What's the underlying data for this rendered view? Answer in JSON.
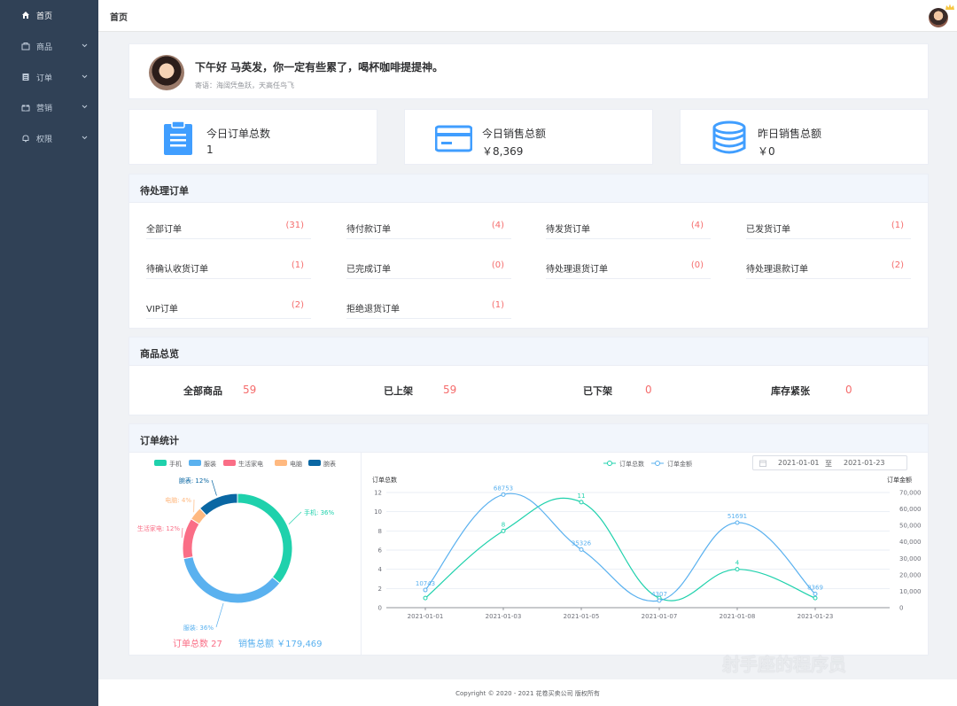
{
  "sidebar": {
    "items": [
      {
        "label": "首页",
        "icon": "home-icon",
        "has_children": false
      },
      {
        "label": "商品",
        "icon": "shop-icon",
        "has_children": true
      },
      {
        "label": "订单",
        "icon": "order-icon",
        "has_children": true
      },
      {
        "label": "营销",
        "icon": "gift-icon",
        "has_children": true
      },
      {
        "label": "权限",
        "icon": "bell-icon",
        "has_children": true
      }
    ],
    "colors": {
      "bg": "#304156",
      "text": "#bfcbd9",
      "active": "#ffffff"
    }
  },
  "header": {
    "breadcrumb": "首页"
  },
  "welcome": {
    "greeting": "下午好 马英发，你一定有些累了，喝杯咖啡提提神。",
    "motto": "寄语：海阔凭鱼跃，天高任鸟飞"
  },
  "stats": [
    {
      "label": "今日订单总数",
      "value": "1",
      "icon": "clipboard-icon"
    },
    {
      "label": "今日销售总额",
      "value": "￥8,369",
      "icon": "card-icon"
    },
    {
      "label": "昨日销售总额",
      "value": "￥0",
      "icon": "coins-icon"
    }
  ],
  "pending_orders": {
    "title": "待处理订单",
    "items": [
      {
        "label": "全部订单",
        "count": "(31)"
      },
      {
        "label": "待付款订单",
        "count": "(4)"
      },
      {
        "label": "待发货订单",
        "count": "(4)"
      },
      {
        "label": "已发货订单",
        "count": "(1)"
      },
      {
        "label": "待确认收货订单",
        "count": "(1)"
      },
      {
        "label": "已完成订单",
        "count": "(0)"
      },
      {
        "label": "待处理退货订单",
        "count": "(0)"
      },
      {
        "label": "待处理退款订单",
        "count": "(2)"
      },
      {
        "label": "VIP订单",
        "count": "(2)"
      },
      {
        "label": "拒绝退货订单",
        "count": "(1)"
      }
    ]
  },
  "goods_overview": {
    "title": "商品总览",
    "items": [
      {
        "label": "全部商品",
        "value": "59"
      },
      {
        "label": "已上架",
        "value": "59"
      },
      {
        "label": "已下架",
        "value": "0"
      },
      {
        "label": "库存紧张",
        "value": "0"
      }
    ]
  },
  "order_stats": {
    "title": "订单统计",
    "order_total_label": "订单总数 27",
    "sales_total_label": "销售总额 ￥179,469",
    "date_from": "2021-01-01",
    "date_sep": "至",
    "date_to": "2021-01-23"
  },
  "chart_data": [
    {
      "type": "pie",
      "legend": [
        "手机",
        "服装",
        "生活家电",
        "电脑",
        "腕表"
      ],
      "slices": [
        {
          "name": "手机",
          "value": 36,
          "label": "手机: 36%",
          "color": "#1fd1ac"
        },
        {
          "name": "服装",
          "value": 36,
          "label": "服装: 36%",
          "color": "#5ab1ef"
        },
        {
          "name": "生活家电",
          "value": 12,
          "label": "生活家电: 12%",
          "color": "#fa6e86"
        },
        {
          "name": "电脑",
          "value": 4,
          "label": "电脑: 4%",
          "color": "#ffb980"
        },
        {
          "name": "腕表",
          "value": 12,
          "label": "腕表: 12%",
          "color": "#0a67a3"
        }
      ],
      "legend_position": "top"
    },
    {
      "type": "line",
      "legend": [
        "订单总数",
        "订单金额"
      ],
      "categories": [
        "2021-01-01",
        "2021-01-03",
        "2021-01-05",
        "2021-01-07",
        "2021-01-08",
        "2021-01-23"
      ],
      "series": [
        {
          "name": "订单总数",
          "axis": "left",
          "color": "#1fd1ac",
          "values": [
            1,
            8,
            11,
            1,
            4,
            1
          ],
          "labels": [
            "",
            "8",
            "11",
            "",
            "4",
            ""
          ]
        },
        {
          "name": "订单金额",
          "axis": "right",
          "color": "#5ab1ef",
          "values": [
            10743,
            68753,
            35326,
            4307,
            51691,
            8369
          ],
          "labels": [
            "10743",
            "68753",
            "35326",
            "4307",
            "51691",
            "8369"
          ]
        }
      ],
      "ylabel_left": "订单总数",
      "ylabel_right": "订单金额",
      "ylim_left": [
        0,
        12
      ],
      "yticks_left": [
        "0",
        "2",
        "4",
        "6",
        "8",
        "10",
        "12"
      ],
      "ylim_right": [
        0,
        70000
      ],
      "yticks_right": [
        "0",
        "10,000",
        "20,000",
        "30,000",
        "40,000",
        "50,000",
        "60,000",
        "70,000"
      ],
      "smooth": true,
      "grid": true
    }
  ],
  "footer": {
    "copyright": "Copyright © 2020 - 2021 花卷买卖公司 版权所有"
  },
  "watermark": {
    "text": "射手座的程序员"
  }
}
